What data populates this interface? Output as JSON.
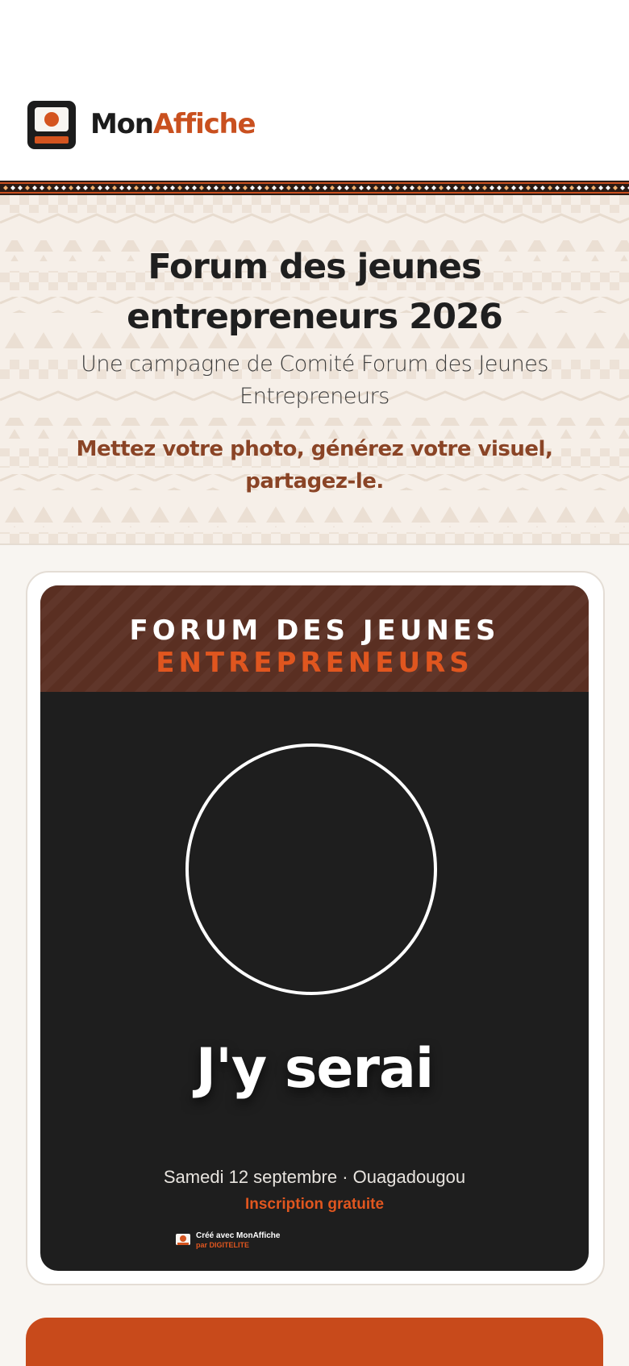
{
  "header": {
    "brand_part1": "Mon",
    "brand_part2": "Affiche"
  },
  "hero": {
    "title": "Forum des jeunes entrepreneurs 2026",
    "subtitle": "Une campagne de Comité Forum des Jeunes Entrepreneurs",
    "cta": "Mettez votre photo, générez votre visuel, partagez-le."
  },
  "poster": {
    "head_line1": "FORUM DES JEUNES",
    "head_line2": "ENTREPRENEURS",
    "headline": "J'y serai",
    "date_place": "Samedi 12 septembre · Ouagadougou",
    "registration": "Inscription gratuite",
    "credit_line1": "Créé avec MonAffiche",
    "credit_line2": "par DIGITELITE"
  },
  "colors": {
    "accent": "#d4541f",
    "brand_dark": "#1c1c1c",
    "poster_head": "#5a2f22",
    "poster_bg": "#1e1e1e",
    "cta_text": "#8a4426",
    "hero_bg": "#f6efe8"
  },
  "icons": {
    "logo": "poster-frame-icon",
    "credit": "mini-logo-icon"
  }
}
